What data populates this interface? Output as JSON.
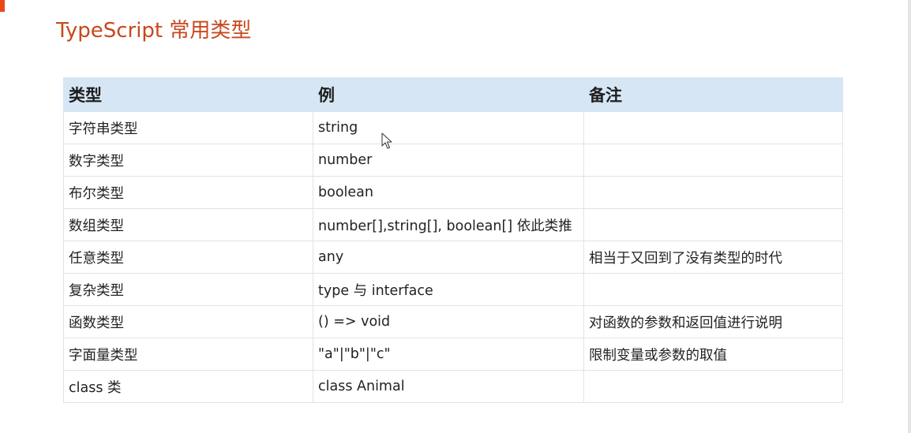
{
  "slide": {
    "title": "TypeScript 常用类型"
  },
  "table": {
    "headers": [
      "类型",
      "例",
      "备注"
    ],
    "rows": [
      [
        "字符串类型",
        "string",
        ""
      ],
      [
        "数字类型",
        "number",
        ""
      ],
      [
        "布尔类型",
        "boolean",
        ""
      ],
      [
        "数组类型",
        "number[],string[], boolean[] 依此类推",
        ""
      ],
      [
        "任意类型",
        "any",
        "相当于又回到了没有类型的时代"
      ],
      [
        "复杂类型",
        "type 与 interface",
        ""
      ],
      [
        "函数类型",
        "() => void",
        "对函数的参数和返回值进行说明"
      ],
      [
        "字面量类型",
        "\"a\"|\"b\"|\"c\"",
        "限制变量或参数的取值"
      ],
      [
        "class 类",
        "class Animal",
        ""
      ]
    ]
  },
  "colors": {
    "title": "#c8481c",
    "accent": "#e8471c",
    "header_bg": "#d6e6f4",
    "border": "#e3e3e3"
  },
  "icons": {
    "cursor": "mouse-pointer-icon"
  }
}
